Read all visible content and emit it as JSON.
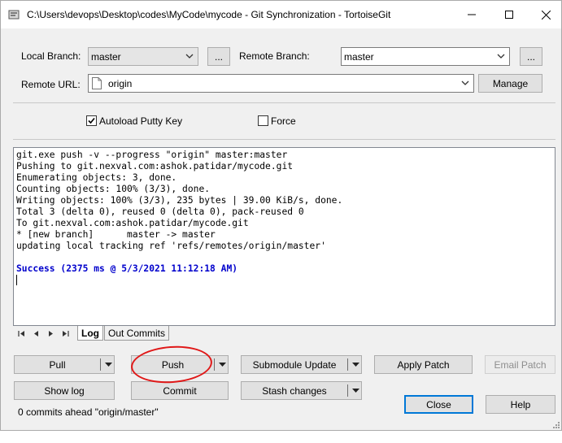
{
  "window": {
    "title": "C:\\Users\\devops\\Desktop\\codes\\MyCode\\mycode - Git Synchronization - TortoiseGit"
  },
  "local_branch": {
    "label": "Local Branch:",
    "value": "master",
    "browse_label": "..."
  },
  "remote_branch": {
    "label": "Remote Branch:",
    "value": "master",
    "browse_label": "..."
  },
  "remote_url": {
    "label": "Remote URL:",
    "value": "origin",
    "manage_label": "Manage"
  },
  "options": {
    "autoload_putty": {
      "label": "Autoload Putty Key",
      "checked": true
    },
    "force": {
      "label": "Force",
      "checked": false
    }
  },
  "output": {
    "lines": [
      "git.exe push -v --progress \"origin\" master:master",
      "Pushing to git.nexval.com:ashok.patidar/mycode.git",
      "Enumerating objects: 3, done.",
      "Counting objects: 100% (3/3), done.",
      "Writing objects: 100% (3/3), 235 bytes | 39.00 KiB/s, done.",
      "Total 3 (delta 0), reused 0 (delta 0), pack-reused 0",
      "To git.nexval.com:ashok.patidar/mycode.git",
      "* [new branch]      master -> master",
      "updating local tracking ref 'refs/remotes/origin/master'"
    ],
    "success": "Success (2375 ms @ 5/3/2021 11:12:18 AM)",
    "success_color": "#0000cc"
  },
  "tabs": {
    "log": "Log",
    "out_commits": "Out Commits"
  },
  "buttons": {
    "pull": "Pull",
    "push": "Push",
    "submodule_update": "Submodule Update",
    "apply_patch": "Apply Patch",
    "email_patch": "Email Patch",
    "show_log": "Show log",
    "commit": "Commit",
    "stash_changes": "Stash changes",
    "close": "Close",
    "help": "Help"
  },
  "status": {
    "text": "0 commits ahead \"origin/master\""
  },
  "colors": {
    "accent": "#0078d7",
    "highlight_circle": "#e01818"
  }
}
